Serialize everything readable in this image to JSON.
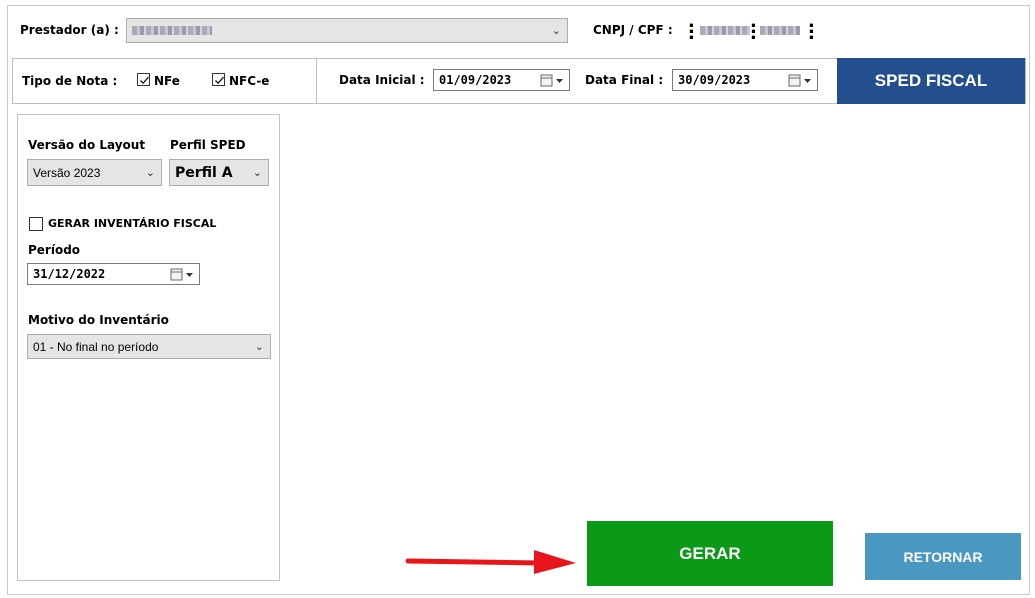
{
  "header": {
    "prestador_label": "Prestador (a) :",
    "cnpj_label": "CNPJ / CPF :"
  },
  "filters": {
    "tipo_nota_label": "Tipo de Nota :",
    "nfe_label": "NFe",
    "nfce_label": "NFC-e",
    "data_inicial_label": "Data Inicial :",
    "data_inicial_value": "01/09/2023",
    "data_final_label": "Data Final :",
    "data_final_value": "30/09/2023",
    "title": "SPED FISCAL"
  },
  "options": {
    "versao_label": "Versão do Layout",
    "versao_value": "Versão 2023",
    "perfil_label": "Perfil SPED",
    "perfil_value": "Perfil A",
    "inventario_label": "GERAR INVENTÁRIO FISCAL",
    "periodo_label": "Período",
    "periodo_value": "31/12/2022",
    "motivo_label": "Motivo do Inventário",
    "motivo_value": "01 - No final no período"
  },
  "actions": {
    "gerar_label": "GERAR",
    "retornar_label": "RETORNAR"
  },
  "colors": {
    "title_bg": "#234f8e",
    "gerar_bg": "#0a9a16",
    "retornar_bg": "#4a97c2",
    "arrow": "#e8161a"
  }
}
